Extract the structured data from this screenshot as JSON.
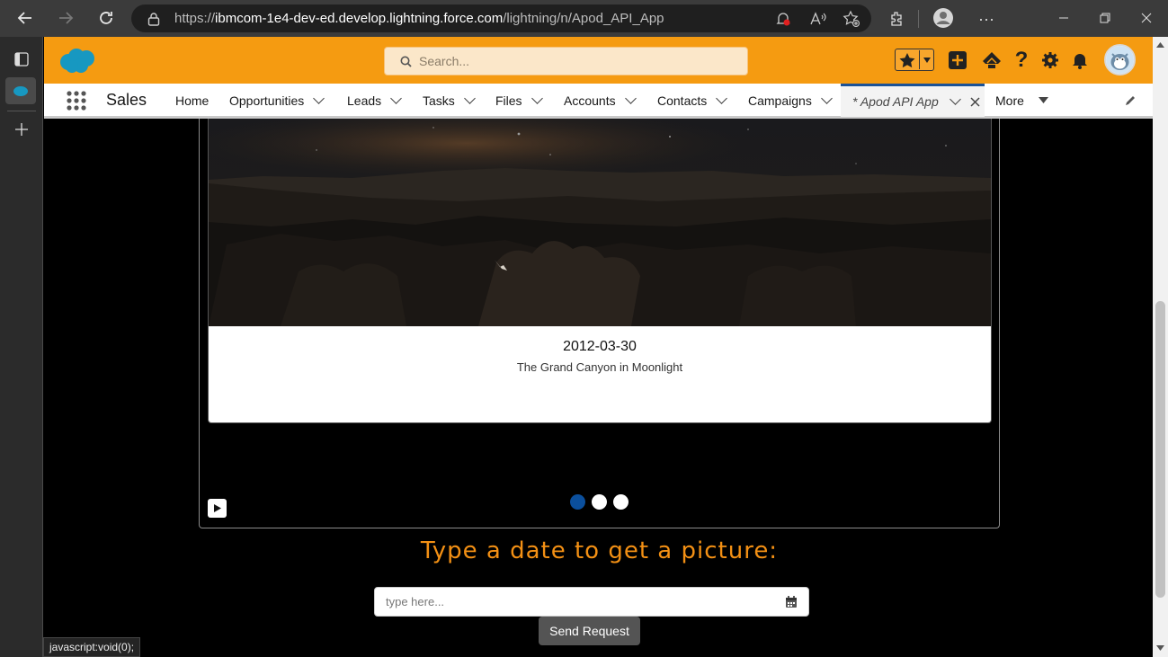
{
  "browser": {
    "url_prefix": "https://",
    "url_host": "ibmcom-1e4-dev-ed.develop.lightning.force.com",
    "url_path": "/lightning/n/Apod_API_App"
  },
  "header": {
    "search_placeholder": "Search..."
  },
  "nav": {
    "app_name": "Sales",
    "items": [
      {
        "label": "Home"
      },
      {
        "label": "Opportunities"
      },
      {
        "label": "Leads"
      },
      {
        "label": "Tasks"
      },
      {
        "label": "Files"
      },
      {
        "label": "Accounts"
      },
      {
        "label": "Contacts"
      },
      {
        "label": "Campaigns"
      }
    ],
    "active_tab": "* Apod API App",
    "more_label": "More"
  },
  "carousel": {
    "date": "2012-03-30",
    "caption": "The Grand Canyon in Moonlight",
    "dots": 3,
    "active_dot": 0
  },
  "form": {
    "heading": "Type a date to get a picture:",
    "input_placeholder": "type here...",
    "submit_label": "Send Request"
  },
  "status_bar": {
    "text": "javascript:void(0);"
  },
  "colors": {
    "brand_orange": "#f59b11",
    "heading_orange": "#f39014",
    "active_dot": "#0b4f9c",
    "button_gray": "#545454"
  }
}
